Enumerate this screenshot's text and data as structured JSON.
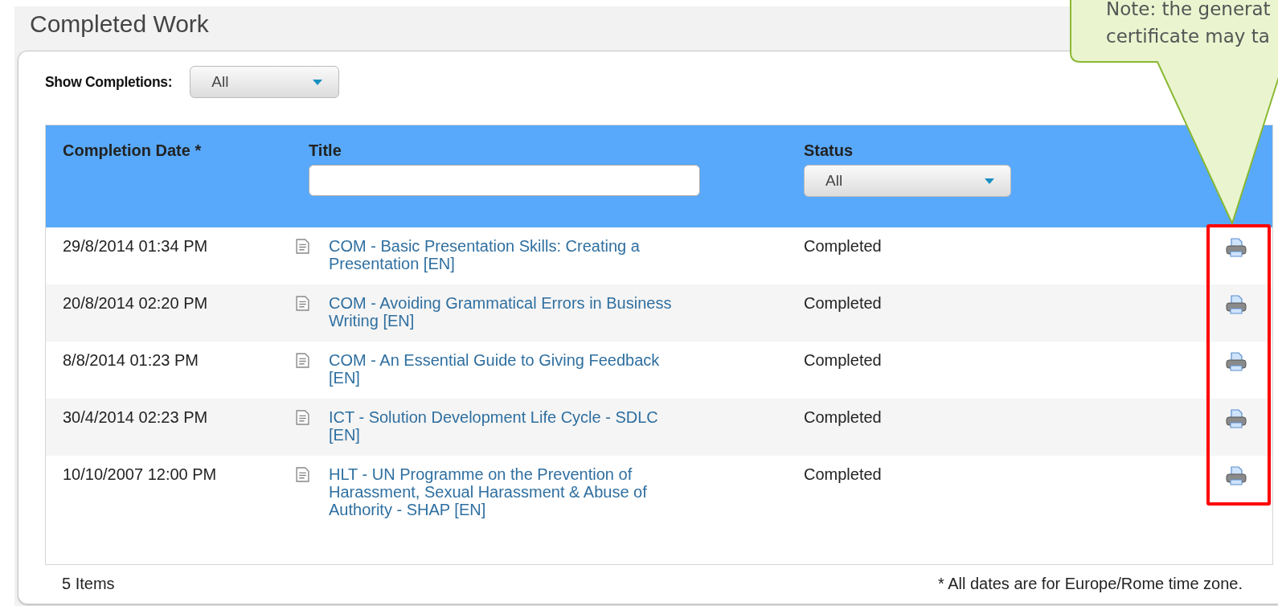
{
  "page_title": "Completed Work",
  "filter": {
    "label": "Show Completions:",
    "value": "All"
  },
  "table": {
    "columns": [
      "Completion Date *",
      "Title",
      "Status"
    ],
    "status_filter": {
      "value": "All"
    },
    "rows": [
      {
        "date": "29/8/2014 01:34 PM",
        "title": "COM - Basic Presentation Skills: Creating a Presentation [EN]",
        "status": "Completed"
      },
      {
        "date": "20/8/2014 02:20 PM",
        "title": "COM - Avoiding Grammatical Errors in Business Writing [EN]",
        "status": "Completed"
      },
      {
        "date": "8/8/2014 01:23 PM",
        "title": "COM - An Essential Guide to Giving Feedback [EN]",
        "status": "Completed"
      },
      {
        "date": "30/4/2014 02:23 PM",
        "title": "ICT - Solution Development Life Cycle - SDLC [EN]",
        "status": "Completed"
      },
      {
        "date": "10/10/2007 12:00 PM",
        "title": "HLT - UN Programme on the Prevention of Harassment, Sexual Harassment & Abuse of Authority - SHAP [EN]",
        "status": "Completed"
      }
    ]
  },
  "footer": {
    "count": "5 Items",
    "note": "* All dates are for Europe/Rome time zone."
  },
  "callout": {
    "lines": [
      "Note: the generat",
      "certificate may ta"
    ]
  }
}
